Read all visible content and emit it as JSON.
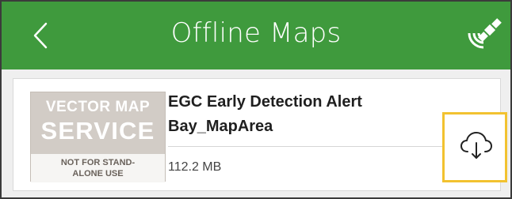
{
  "header": {
    "title": "Offline Maps",
    "back_icon": "chevron-left-icon",
    "gps_icon": "satellite-icon",
    "background_color": "#3f9a3d"
  },
  "map_area": {
    "thumbnail": {
      "line1": "VECTOR MAP",
      "line2": "SERVICE",
      "line3a": "NOT FOR STAND-",
      "line3b": "ALONE USE"
    },
    "name_line1": "EGC Early Detection Alert",
    "name_line2": "Bay_MapArea",
    "size": "112.2 MB",
    "download_icon": "cloud-download-icon",
    "highlight_color": "#f2c230"
  }
}
